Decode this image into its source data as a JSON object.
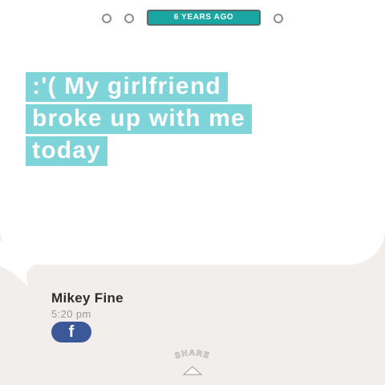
{
  "pager": {
    "label": "6 YEARS AGO",
    "dots": [
      "page-1",
      "page-2",
      "page-4"
    ]
  },
  "message": {
    "lines": [
      ":'( My girlfriend",
      "broke up with me",
      "today"
    ]
  },
  "author": {
    "name": "Mikey Fine",
    "time": "5:20 pm",
    "network": "f"
  },
  "share": {
    "label": "SHARE",
    "icon": "chevron-up-icon"
  },
  "colors": {
    "accent": "#1aa6a3",
    "highlight": "#7fd4d9",
    "facebook": "#3b5998",
    "background": "#f2eeec"
  }
}
